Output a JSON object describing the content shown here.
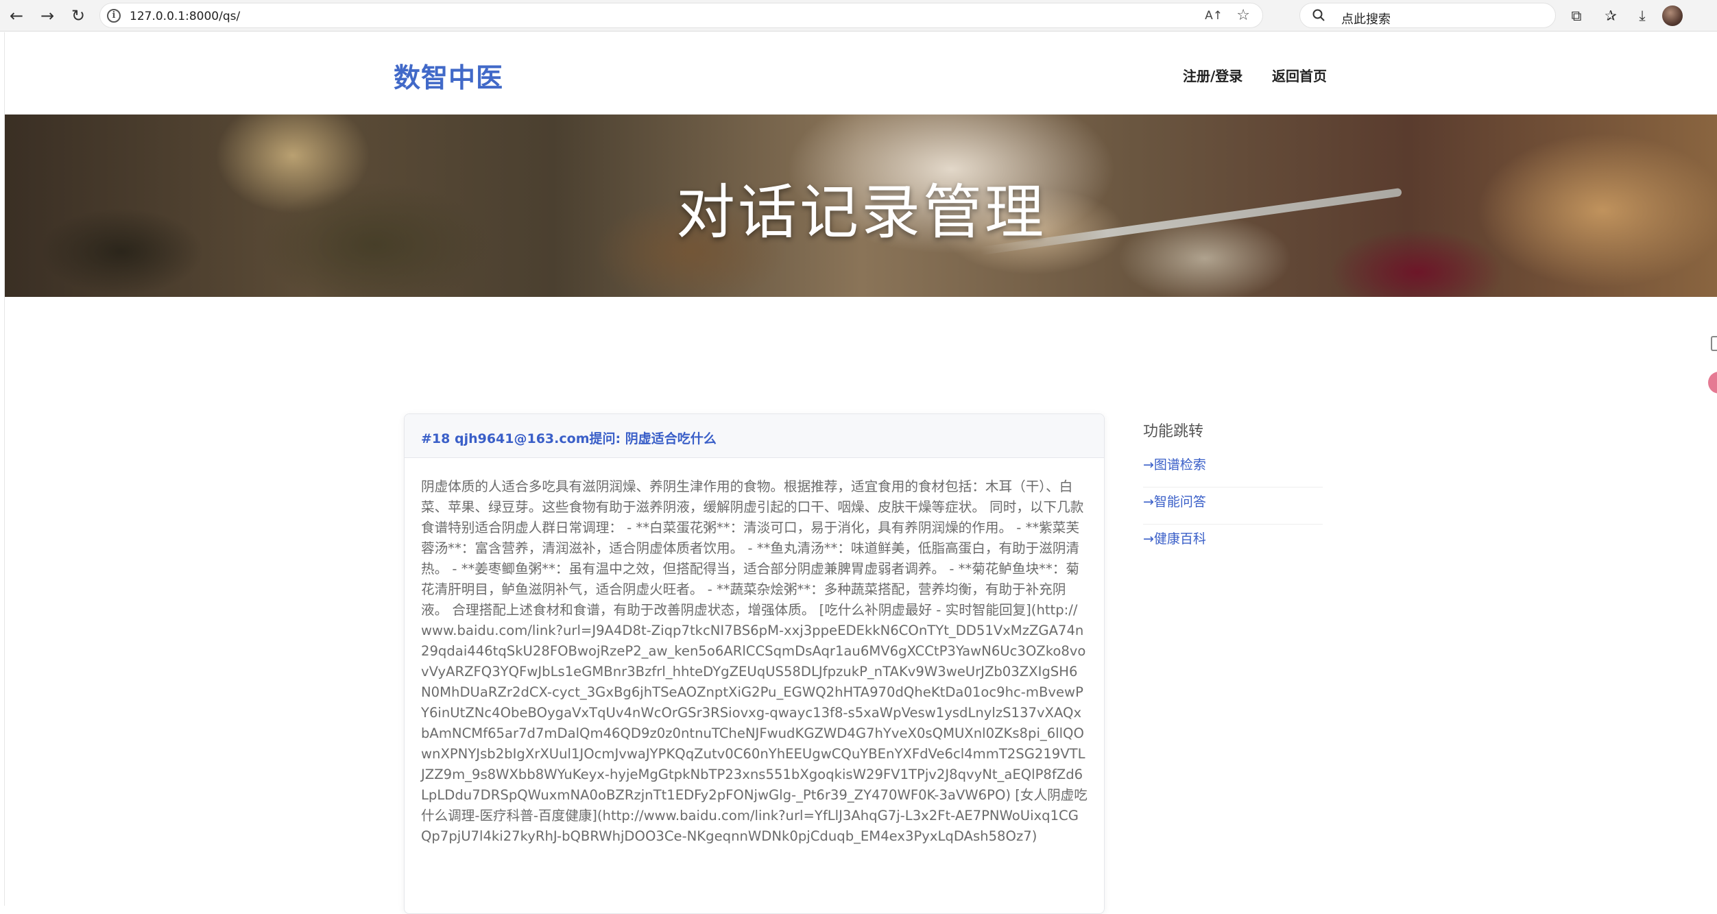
{
  "browser": {
    "url": "127.0.0.1:8000/qs/",
    "search_placeholder": "点此搜索",
    "info_glyph": "i",
    "read_aloud_glyph": "A↑",
    "back_glyph": "←",
    "forward_glyph": "→",
    "reload_glyph": "↻",
    "favorite_glyph": "☆",
    "extensions_glyph": "⧉",
    "favorites_bar_glyph": "✰",
    "download_glyph": "⤓"
  },
  "site": {
    "logo": "数智中医",
    "nav": {
      "register_login": "注册/登录",
      "home": "返回首页"
    }
  },
  "hero": {
    "title": "对话记录管理"
  },
  "record": {
    "title": "#18 qjh9641@163.com提问: 阴虚适合吃什么",
    "answer": "阴虚体质的人适合多吃具有滋阴润燥、养阴生津作用的食物。根据推荐，适宜食用的食材包括：木耳（干）、白菜、苹果、绿豆芽。这些食物有助于滋养阴液，缓解阴虚引起的口干、咽燥、皮肤干燥等症状。 同时，以下几款食谱特别适合阴虚人群日常调理： - **白菜蛋花粥**：清淡可口，易于消化，具有养阴润燥的作用。 - **紫菜芙蓉汤**：富含营养，清润滋补，适合阴虚体质者饮用。 - **鱼丸清汤**：味道鲜美，低脂高蛋白，有助于滋阴清热。 - **姜枣鲫鱼粥**：虽有温中之效，但搭配得当，适合部分阴虚兼脾胃虚弱者调养。 - **菊花鲈鱼块**：菊花清肝明目，鲈鱼滋阴补气，适合阴虚火旺者。 - **蔬菜杂烩粥**：多种蔬菜搭配，营养均衡，有助于补充阴液。 合理搭配上述食材和食谱，有助于改善阴虚状态，增强体质。 [吃什么补阴虚最好 - 实时智能回复](http://www.baidu.com/link?url=J9A4D8t-Ziqp7tkcNI7BS6pM-xxj3ppeEDEkkN6COnTYt_DD51VxMzZGA74n29qdai446tqSkU28FOBwojRzeP2_aw_ken5o6ARlCCSqmDsAqr1au6MV6gXCCtP3YawN6Uc3OZko8vovVyARZFQ3YQFwJbLs1eGMBnr3Bzfrl_hhteDYgZEUqUS58DLJfpzukP_nTAKv9W3weUrJZb03ZXIgSH6N0MhDUaRZr2dCX-cyct_3GxBg6jhTSeAOZnptXiG2Pu_EGWQ2hHTA970dQheKtDa01oc9hc-mBvewPY6inUtZNc4ObeBOygaVxTqUv4nWcOrGSr3RSiovxg-qwayc13f8-s5xaWpVesw1ysdLnylzS137vXAQxbAmNCMf65ar7d7mDalQm46QD9z0z0ntnuTCheNJFwudKGZWD4G7hYveX0sQMUXnl0ZKs8pi_6llQOwnXPNYJsb2bIgXrXUul1JOcmJvwaJYPKQqZutv0C60nYhEEUgwCQuYBEnYXFdVe6cl4mmT2SG219VTLJZZ9m_9s8WXbb8WYuKeyx-hyjeMgGtpkNbTP23xns551bXgoqkisW29FV1TPjv2J8qvyNt_aEQlP8fZd6LpLDdu7DRSpQWuxmNA0oBZRzjnTt1EDFy2pFONjwGlg-_Pt6r39_ZY470WF0K-3aVW6PO) [女人阴虚吃什么调理-医疗科普-百度健康](http://www.baidu.com/link?url=YfLlJ3AhqG7j-L3x2Ft-AE7PNWoUixq1CGQp7pjU7l4ki27kyRhJ-bQBRWhjDOO3Ce-NKgeqnnWDNk0pjCduqb_EM4ex3PyxLqDAsh58Oz7)"
  },
  "sidebar": {
    "title": "功能跳转",
    "links": [
      "→图谱检索",
      "→智能问答",
      "→健康百科"
    ]
  }
}
